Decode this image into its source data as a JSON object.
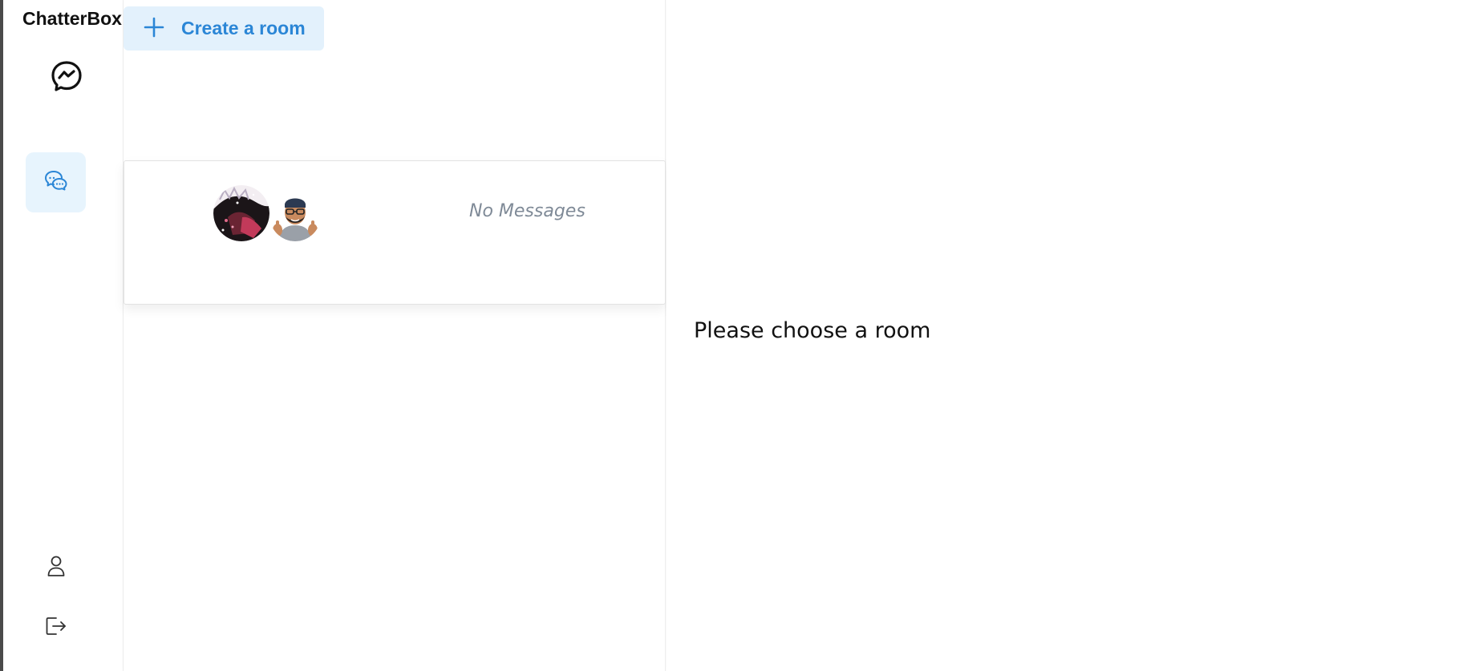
{
  "app": {
    "brand": "ChatterBox",
    "accent_color": "#2b86d6",
    "accent_bg": "#e3f1fc"
  },
  "rail": {
    "logo_icon": "messenger-bubble-icon",
    "items": [
      {
        "id": "chats",
        "icon": "chat-bubbles-icon",
        "active": true
      },
      {
        "id": "profile",
        "icon": "user-icon",
        "active": false
      },
      {
        "id": "logout",
        "icon": "logout-icon",
        "active": false
      }
    ]
  },
  "room_list": {
    "create_button": {
      "label": "Create a room",
      "icon": "plus-icon"
    },
    "rooms": [
      {
        "avatars": [
          "anime-character-avatar",
          "memoji-thumbs-up-avatar"
        ],
        "last_message": "No Messages"
      }
    ]
  },
  "main": {
    "empty_state": "Please choose a room"
  }
}
